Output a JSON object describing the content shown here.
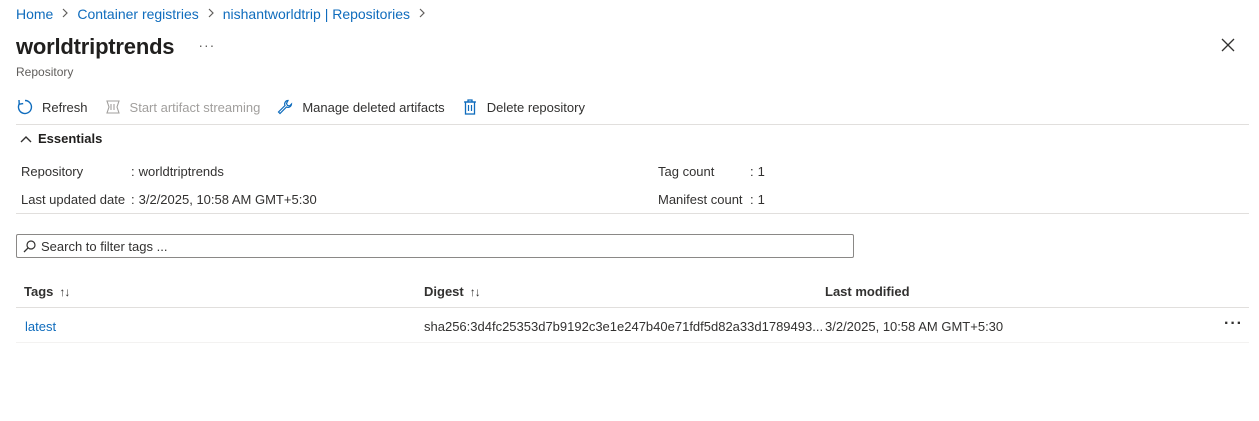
{
  "breadcrumb": [
    "Home",
    "Container registries",
    "nishantworldtrip | Repositories"
  ],
  "header": {
    "title": "worldtriptrends",
    "more": "···",
    "subtitle": "Repository"
  },
  "toolbar": {
    "refresh": "Refresh",
    "start_streaming": "Start artifact streaming",
    "manage_deleted": "Manage deleted artifacts",
    "delete_repo": "Delete repository"
  },
  "essentials": {
    "label": "Essentials",
    "repository_label": "Repository",
    "repository_value": "worldtriptrends",
    "last_updated_label": "Last updated date",
    "last_updated_value": "3/2/2025, 10:58 AM GMT+5:30",
    "tag_count_label": "Tag count",
    "tag_count_value": "1",
    "manifest_count_label": "Manifest count",
    "manifest_count_value": "1"
  },
  "search": {
    "placeholder": "Search to filter tags ..."
  },
  "table": {
    "columns": [
      "Tags",
      "Digest",
      "Last modified"
    ],
    "rows": [
      {
        "tag": "latest",
        "digest": "sha256:3d4fc25353d7b9192c3e1e247b40e71fdf5d82a33d1789493...",
        "last_modified": "3/2/2025, 10:58 AM GMT+5:30",
        "more": "···"
      }
    ]
  },
  "colors": {
    "link": "#0f6cbd",
    "text": "#323130",
    "disabled": "#a19f9d",
    "border": "#e1dfdd"
  },
  "icons": [
    "refresh-icon",
    "streaming-icon",
    "wrench-icon",
    "trash-icon",
    "close-icon",
    "chevron-up-icon",
    "search-icon",
    "chevron-right-icon"
  ]
}
